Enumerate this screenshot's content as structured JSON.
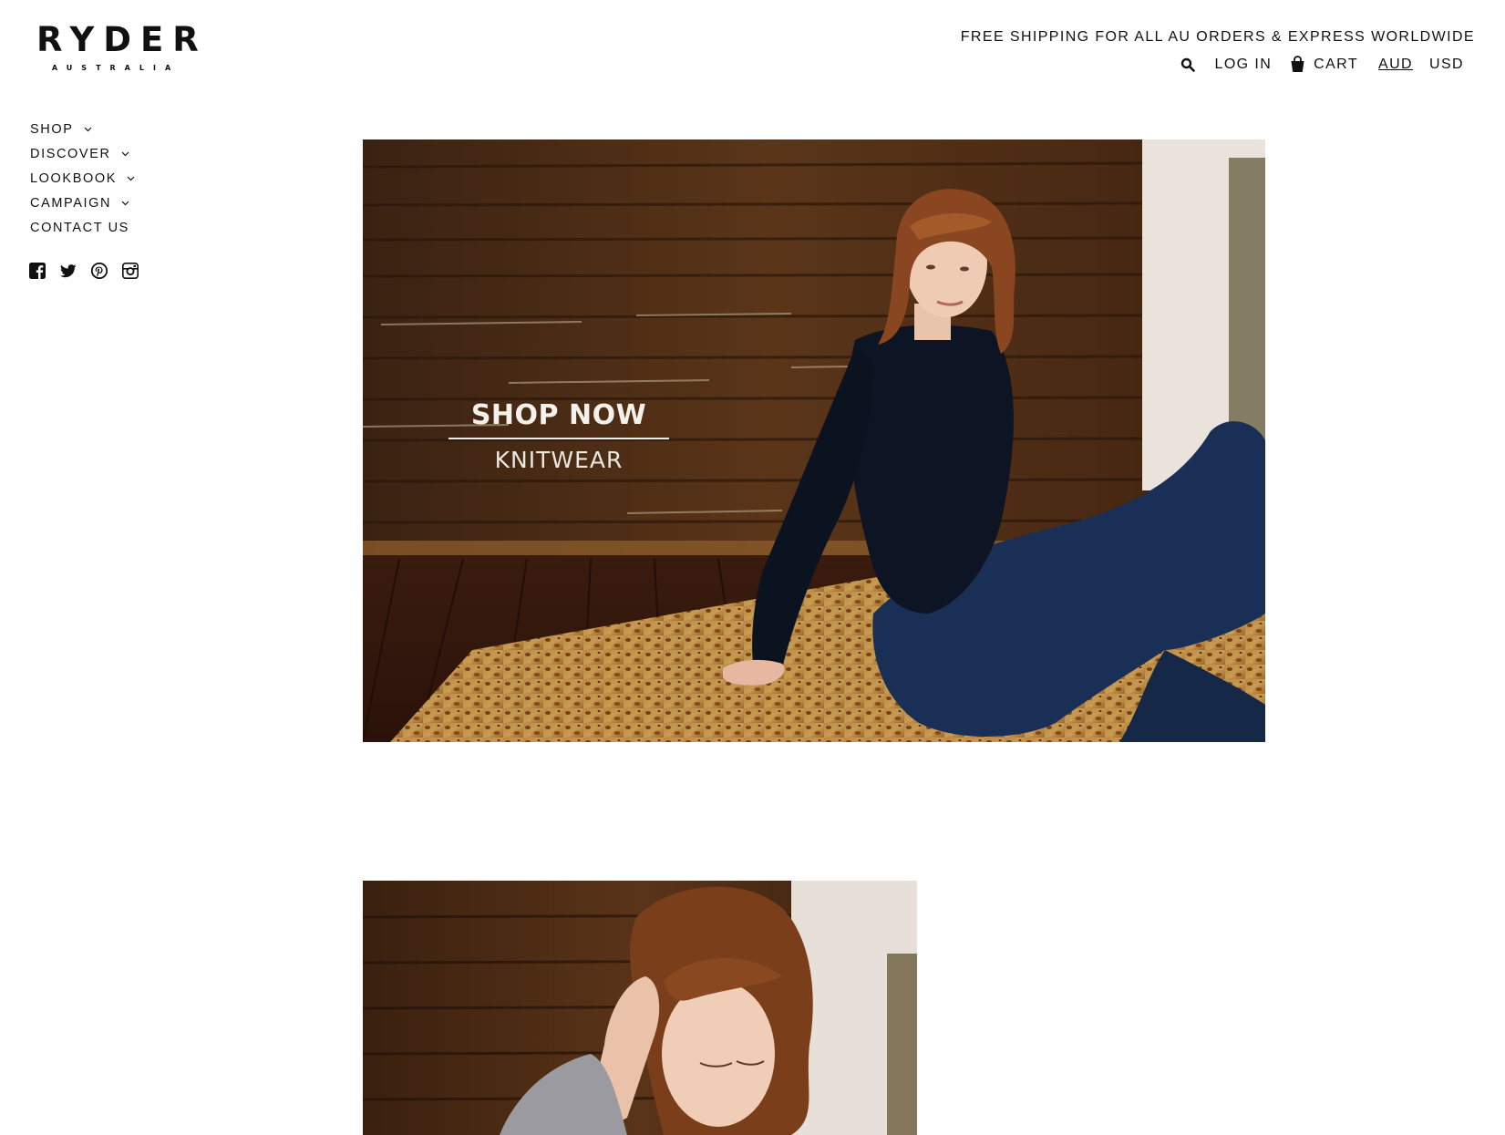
{
  "brand": {
    "name": "RYDER",
    "sub": "AUSTRALIA"
  },
  "header": {
    "promo": "FREE SHIPPING FOR ALL AU ORDERS & EXPRESS WORLDWIDE",
    "search_icon": "search-icon",
    "login_label": "LOG IN",
    "cart_icon": "shopping-bag-icon",
    "cart_label": "CART",
    "currencies": [
      "AUD",
      "USD"
    ],
    "selected_currency": "AUD"
  },
  "nav": {
    "items": [
      {
        "label": "SHOP",
        "has_dropdown": true
      },
      {
        "label": "DISCOVER",
        "has_dropdown": true
      },
      {
        "label": "LOOKBOOK",
        "has_dropdown": true
      },
      {
        "label": "CAMPAIGN",
        "has_dropdown": true
      },
      {
        "label": "CONTACT US",
        "has_dropdown": false
      }
    ]
  },
  "social": [
    "facebook-icon",
    "twitter-icon",
    "pinterest-icon",
    "instagram-icon"
  ],
  "hero": {
    "cta_title": "SHOP NOW",
    "cta_subtitle": "KNITWEAR"
  },
  "colors": {
    "text": "#111111",
    "background": "#ffffff",
    "wood": "#4a2a16",
    "cta_text": "#f4f0ea"
  }
}
